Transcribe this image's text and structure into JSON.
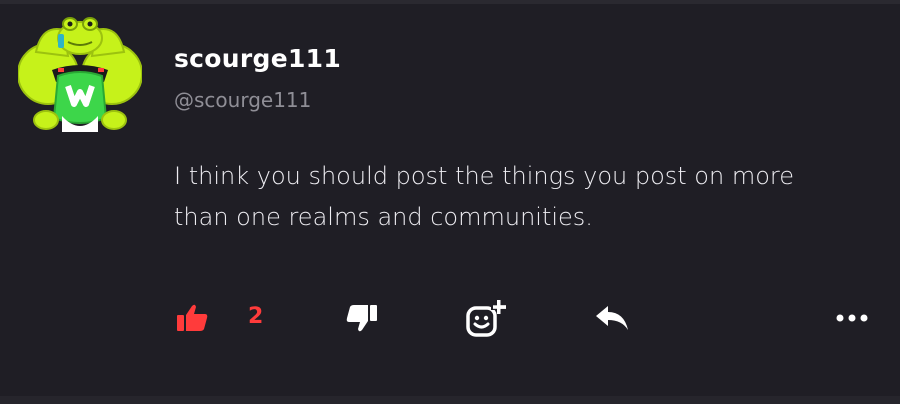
{
  "post": {
    "display_name": "scourge111",
    "handle": "@scourge111",
    "body": "I think you should post the things you post on more than one realms and communities.",
    "avatar_icon": "muscular-frog-avatar"
  },
  "actions": {
    "like_icon": "thumbs-up-icon",
    "like_count": "2",
    "like_color": "#ff3b3b",
    "dislike_icon": "thumbs-down-icon",
    "react_icon": "add-reaction-icon",
    "reply_icon": "reply-arrow-icon",
    "more_icon": "more-options-icon"
  },
  "colors": {
    "background": "#1f1e25",
    "text": "#eeedf2",
    "muted": "#8f8e96",
    "accent": "#ff3b3b",
    "avatar_green": "#c6f21a"
  }
}
